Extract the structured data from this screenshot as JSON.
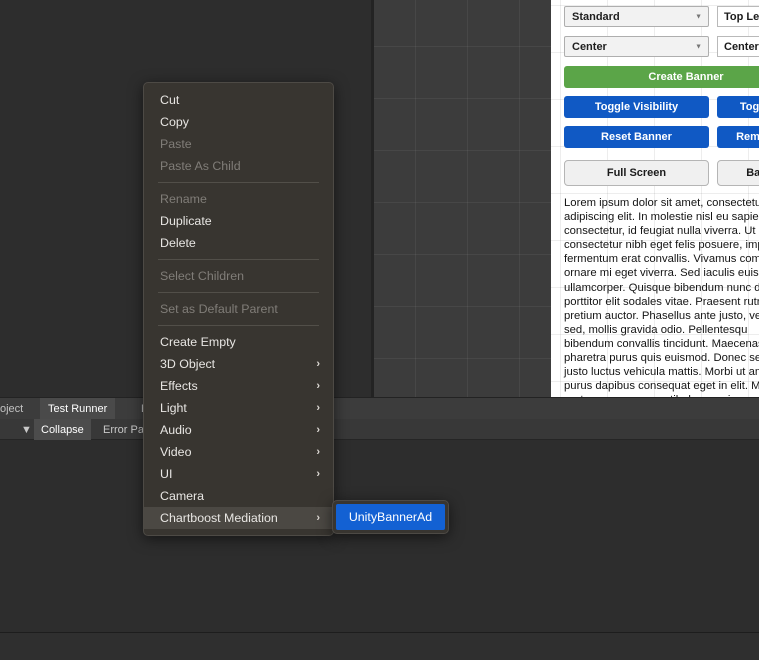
{
  "game_view": {
    "name": "game-view-grid"
  },
  "canvas_panel": {
    "dropdowns": [
      {
        "label": "Standard",
        "caret": "chevron-down-icon"
      },
      {
        "label": "Center",
        "caret": "chevron-down-icon"
      }
    ],
    "fields": [
      {
        "label": "Top Left"
      },
      {
        "label": "Center"
      }
    ],
    "create_banner": {
      "label": "Create Banner",
      "color": "#5ba548"
    },
    "buttons": [
      {
        "label": "Toggle Visibility",
        "color": "#1059c4"
      },
      {
        "label": "Toggle D",
        "color": "#1059c4"
      },
      {
        "label": "Reset Banner",
        "color": "#1059c4"
      },
      {
        "label": "Remove B",
        "color": "#1059c4"
      }
    ],
    "mode_buttons": [
      {
        "label": "Full Screen"
      },
      {
        "label": "Banne"
      }
    ],
    "lorem": "Lorem ipsum dolor sit amet, consectetur adipiscing elit. In molestie nisl eu sapien consectetur, id feugiat nulla viverra. Ut consectetur nibh eget felis posuere, imp fermentum erat convallis. Vivamus com ornare mi eget viverra. Sed iaculis euism ullamcorper. Quisque bibendum nunc di porttitor elit sodales vitae. Praesent rutru pretium auctor. Phasellus ante justo, ve mi sed, mollis gravida odio. Pellentesqu bibendum convallis tincidunt. Maecenas pharetra purus quis euismod. Donec se justo luctus vehicula mattis. Morbi ut am purus dapibus consequat eget in elit. Ma porta neque, non vestibulum sapien."
  },
  "console": {
    "tabs": [
      {
        "label": "oject",
        "active": false
      },
      {
        "label": "Test Runner",
        "active": true
      },
      {
        "label": "E",
        "active": false
      }
    ],
    "toolbar": [
      {
        "label": "▼",
        "icon": "chevron-down-icon"
      },
      {
        "label": "Collapse",
        "pressed": true
      },
      {
        "label": "Error Pause",
        "pressed": false
      }
    ]
  },
  "context_menu": {
    "items": [
      {
        "label": "Cut",
        "disabled": false,
        "submenu": false
      },
      {
        "label": "Copy",
        "disabled": false,
        "submenu": false
      },
      {
        "label": "Paste",
        "disabled": true,
        "submenu": false
      },
      {
        "label": "Paste As Child",
        "disabled": true,
        "submenu": false
      },
      {
        "separator": true
      },
      {
        "label": "Rename",
        "disabled": true,
        "submenu": false
      },
      {
        "label": "Duplicate",
        "disabled": false,
        "submenu": false
      },
      {
        "label": "Delete",
        "disabled": false,
        "submenu": false
      },
      {
        "separator": true
      },
      {
        "label": "Select Children",
        "disabled": true,
        "submenu": false
      },
      {
        "separator": true
      },
      {
        "label": "Set as Default Parent",
        "disabled": true,
        "submenu": false
      },
      {
        "separator": true
      },
      {
        "label": "Create Empty",
        "disabled": false,
        "submenu": false
      },
      {
        "label": "3D Object",
        "disabled": false,
        "submenu": true
      },
      {
        "label": "Effects",
        "disabled": false,
        "submenu": true
      },
      {
        "label": "Light",
        "disabled": false,
        "submenu": true
      },
      {
        "label": "Audio",
        "disabled": false,
        "submenu": true
      },
      {
        "label": "Video",
        "disabled": false,
        "submenu": true
      },
      {
        "label": "UI",
        "disabled": false,
        "submenu": true
      },
      {
        "label": "Camera",
        "disabled": false,
        "submenu": false
      },
      {
        "label": "Chartboost Mediation",
        "disabled": false,
        "submenu": true,
        "highlighted": true
      }
    ],
    "submenu_arrow": "chevron-right-icon"
  },
  "submenu": {
    "items": [
      {
        "label": "UnityBannerAd",
        "selected": true
      }
    ],
    "highlight_color": "#1361d3"
  }
}
